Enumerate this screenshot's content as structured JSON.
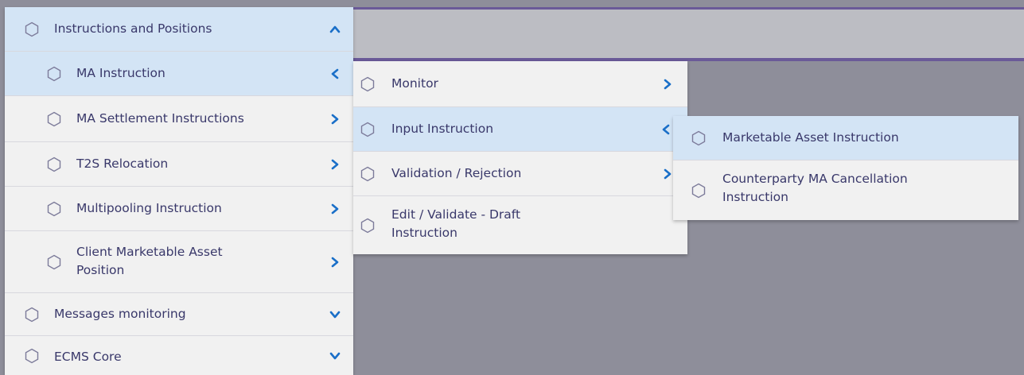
{
  "colors": {
    "accent": "#1a6fc8",
    "text": "#39386a",
    "active_bg": "#d3e4f5",
    "panel_bg": "#f1f1f1",
    "backdrop": "#8e8e9a"
  },
  "menu": {
    "section": {
      "label": "Instructions and Positions",
      "icon": "hexagon-icon",
      "chevron": "chevron-up-icon"
    },
    "items": [
      {
        "label": "MA Instruction",
        "icon": "hexagon-icon",
        "chevron": "chevron-left-icon",
        "active": true
      },
      {
        "label": "MA Settlement Instructions",
        "icon": "hexagon-icon",
        "chevron": "chevron-right-icon"
      },
      {
        "label": "T2S Relocation",
        "icon": "hexagon-icon",
        "chevron": "chevron-right-icon"
      },
      {
        "label": "Multipooling Instruction",
        "icon": "hexagon-icon",
        "chevron": "chevron-right-icon"
      },
      {
        "label": "Client Marketable Asset Position",
        "icon": "hexagon-icon",
        "chevron": "chevron-right-icon"
      }
    ],
    "collapsed": [
      {
        "label": "Messages monitoring",
        "icon": "hexagon-icon",
        "chevron": "chevron-down-icon"
      },
      {
        "label": "ECMS Core",
        "icon": "hexagon-icon",
        "chevron": "chevron-down-icon"
      }
    ]
  },
  "submenu": {
    "items": [
      {
        "label": "Monitor",
        "chevron": "chevron-right-icon"
      },
      {
        "label": "Input Instruction",
        "chevron": "chevron-left-icon",
        "active": true
      },
      {
        "label": "Validation / Rejection",
        "chevron": "chevron-right-icon"
      },
      {
        "label": "Edit / Validate - Draft Instruction",
        "chevron": ""
      }
    ]
  },
  "flyout": {
    "items": [
      {
        "label": "Marketable Asset Instruction",
        "active": true
      },
      {
        "label": "Counterparty MA Cancellation Instruction"
      }
    ]
  }
}
